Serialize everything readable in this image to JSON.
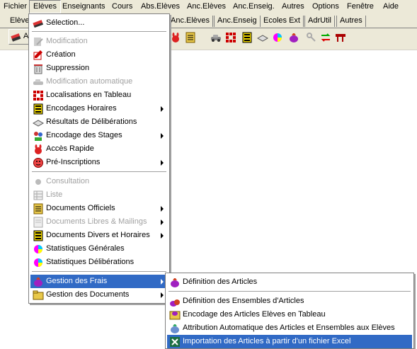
{
  "menubar": {
    "items": [
      "Fichier",
      "Elèves",
      "Enseignants",
      "Cours",
      "Abs.Elèves",
      "Anc.Elèves",
      "Anc.Enseig.",
      "Autres",
      "Options",
      "Fenêtre",
      "Aide"
    ],
    "active_index": 1
  },
  "tabs": {
    "left": "Elève",
    "items": [
      "Anc.Elèves",
      "Anc.Enseig",
      "Ecoles Ext",
      "AdrUtil",
      "Autres"
    ]
  },
  "toolbar": {
    "first_label": "A"
  },
  "eleves_menu": {
    "items": [
      {
        "label": "Sélection...",
        "icon": "eraser-icon",
        "enabled": true,
        "submenu": false
      },
      {
        "label": "Modification",
        "icon": "edit-icon",
        "enabled": false,
        "submenu": false
      },
      {
        "label": "Création",
        "icon": "create-icon",
        "enabled": true,
        "submenu": false
      },
      {
        "label": "Suppression",
        "icon": "trash-icon",
        "enabled": true,
        "submenu": false
      },
      {
        "label": "Modification automatique",
        "icon": "car-icon",
        "enabled": false,
        "submenu": false
      },
      {
        "label": "Localisations en Tableau",
        "icon": "grid-icon",
        "enabled": true,
        "submenu": false
      },
      {
        "label": "Encodages Horaires",
        "icon": "schedule-icon",
        "enabled": true,
        "submenu": true
      },
      {
        "label": "Résultats de Délibérations",
        "icon": "scroll-icon",
        "enabled": true,
        "submenu": false
      },
      {
        "label": "Encodage des Stages",
        "icon": "stages-icon",
        "enabled": true,
        "submenu": true
      },
      {
        "label": "Accès Rapide",
        "icon": "rabbit-icon",
        "enabled": true,
        "submenu": false
      },
      {
        "label": "Pré-Inscriptions",
        "icon": "smiley-icon",
        "enabled": true,
        "submenu": true
      },
      {
        "label": "Consultation",
        "icon": "consult-icon",
        "enabled": false,
        "submenu": false
      },
      {
        "label": "Liste",
        "icon": "list-icon",
        "enabled": false,
        "submenu": false
      },
      {
        "label": "Documents Officiels",
        "icon": "document-icon",
        "enabled": true,
        "submenu": true
      },
      {
        "label": "Documents Libres  & Mailings",
        "icon": "mailing-icon",
        "enabled": false,
        "submenu": true
      },
      {
        "label": "Documents Divers et Horaires",
        "icon": "documents-icon",
        "enabled": true,
        "submenu": true
      },
      {
        "label": "Statistiques Générales",
        "icon": "pie-chart-icon",
        "enabled": true,
        "submenu": false
      },
      {
        "label": "Statistiques Délibérations",
        "icon": "pie-chart-icon",
        "enabled": true,
        "submenu": false
      },
      {
        "label": "Gestion des Frais",
        "icon": "money-bag-icon",
        "enabled": true,
        "submenu": true,
        "highlighted": true
      },
      {
        "label": "Gestion des Documents",
        "icon": "folder-icon",
        "enabled": true,
        "submenu": true
      }
    ]
  },
  "frais_submenu": {
    "items": [
      {
        "label": "Définition des Articles",
        "icon": "money-bag-icon"
      },
      {
        "label": "Définition des Ensembles d'Articles",
        "icon": "money-bags-icon"
      },
      {
        "label": "Encodage des Articles Elèves en Tableau",
        "icon": "table-icon"
      },
      {
        "label": "Attribution Automatique des Articles et Ensembles aux Elèves",
        "icon": "auto-assign-icon"
      },
      {
        "label": "Importation des Articles à partir d'un fichier Excel",
        "icon": "excel-icon",
        "highlighted": true
      }
    ]
  },
  "colors": {
    "highlight": "#316ac5",
    "menu_bg": "#ece9d8"
  }
}
